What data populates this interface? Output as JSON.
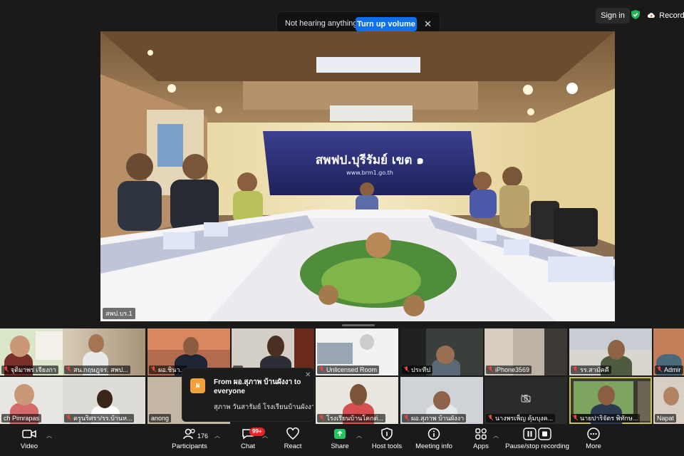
{
  "top": {
    "sign_in": "Sign in",
    "recording": "Recording"
  },
  "banner": {
    "message": "Not hearing anything?",
    "button": "Turn up volume"
  },
  "main_video": {
    "name": "สพป.บร.1",
    "banner_text": "สพฟป.บุรีรัมย์ เขต ๑",
    "banner_url": "www.brm1.go.th"
  },
  "gallery": [
    {
      "name": "จุติมาพร เจียงกา"
    },
    {
      "name": "สน.กฤษฎุจร. สพป..."
    },
    {
      "name": "ผอ.ชินา..."
    },
    {
      "name": "..."
    },
    {
      "name": "Unlicensed Room"
    },
    {
      "name": "ประทีป"
    },
    {
      "name": "iPhone3569"
    },
    {
      "name": "รร.สามัคคี"
    },
    {
      "name": "Admir"
    },
    {
      "name": "ch Pimrapas"
    },
    {
      "name": "ครูนริศรา/รร.บ้านห..."
    },
    {
      "name": "anong"
    },
    {
      "name": "โรงเรียนบ้านโคกต่..."
    },
    {
      "name": "ผอ.สุภาพ บ้านผังงา"
    },
    {
      "name": "นางพรเพ็ญ คุ้มบุงค..."
    },
    {
      "name": "นายปาริจัตร พิทักษ..."
    },
    {
      "name": "Napat"
    }
  ],
  "chat_popup": {
    "avatar": "ผ",
    "from": "From ผอ.สุภาพ บ้านผังงา to everyone",
    "message": "สุภาพ วันสารัมย์ โรงเรียนบ้านผังงา"
  },
  "toolbar": {
    "video": "Video",
    "participants": "Participants",
    "participant_count": "176",
    "chat": "Chat",
    "chat_badge": "99+",
    "react": "React",
    "share": "Share",
    "host_tools": "Host tools",
    "meeting_info": "Meeting info",
    "apps": "Apps",
    "recording": "Pause/stop recording",
    "more": "More"
  },
  "colors": {
    "accent": "#0e71eb",
    "share_green": "#22c55e",
    "badge_red": "#e02828",
    "mic_muted": "#e5483b"
  }
}
